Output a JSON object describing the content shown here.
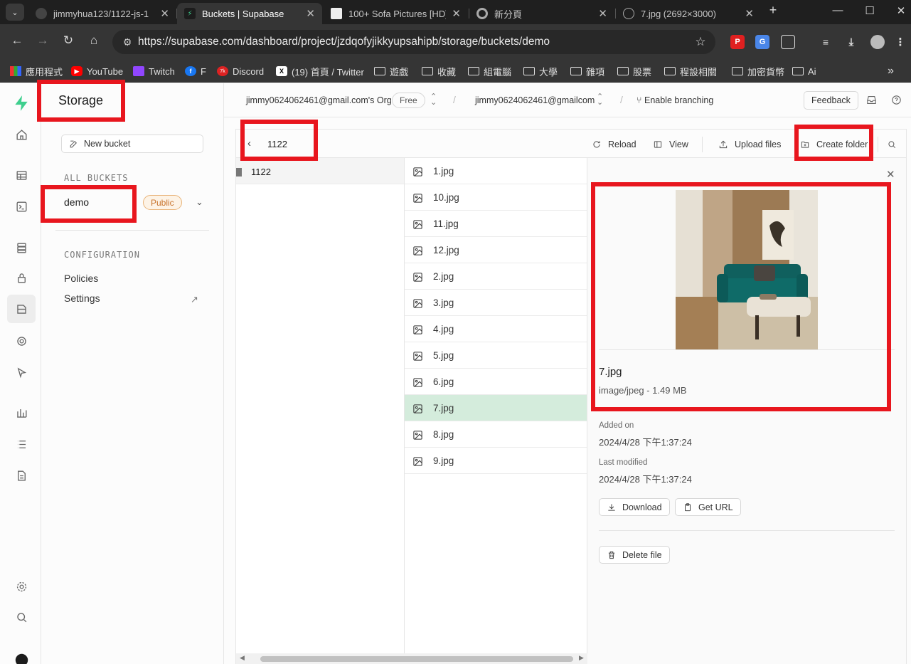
{
  "browser": {
    "tabs": [
      {
        "title": "jimmyhua123/1122-js-1",
        "close": "✕"
      },
      {
        "title": "Buckets | Supabase",
        "close": "✕"
      },
      {
        "title": "100+ Sofa Pictures [HD]",
        "close": "✕"
      },
      {
        "title": "新分頁",
        "close": "✕"
      },
      {
        "title": "7.jpg (2692×3000)",
        "close": "✕"
      }
    ],
    "new_tab": "+",
    "url": "https://supabase.com/dashboard/project/jzdqofyjikkyupsahipb/storage/buckets/demo",
    "bookmarks": [
      {
        "label": "應用程式",
        "icon": "apps-grid-icon"
      },
      {
        "label": "YouTube",
        "icon": "youtube-icon"
      },
      {
        "label": "Twitch",
        "icon": "twitch-icon"
      },
      {
        "label": "F",
        "icon": "facebook-icon"
      },
      {
        "label": "Discord",
        "icon": "discord-icon"
      },
      {
        "label": "(19) 首頁 / Twitter",
        "icon": "x-icon"
      },
      {
        "label": "遊戲",
        "icon": "folder-icon"
      },
      {
        "label": "收藏",
        "icon": "folder-icon"
      },
      {
        "label": "組電腦",
        "icon": "folder-icon"
      },
      {
        "label": "大學",
        "icon": "folder-icon"
      },
      {
        "label": "雜項",
        "icon": "folder-icon"
      },
      {
        "label": "股票",
        "icon": "folder-icon"
      },
      {
        "label": "程設相關",
        "icon": "folder-icon"
      },
      {
        "label": "加密貨幣",
        "icon": "folder-icon"
      },
      {
        "label": "Ai",
        "icon": "folder-icon"
      }
    ],
    "more_bookmarks": "»"
  },
  "sidebar": {
    "title": "Storage",
    "new_bucket_label": "New bucket",
    "all_buckets_heading": "ALL BUCKETS",
    "bucket": {
      "name": "demo",
      "badge": "Public"
    },
    "configuration_heading": "CONFIGURATION",
    "links": [
      "Policies",
      "Settings"
    ]
  },
  "topbar": {
    "org": "jimmy0624062461@gmail.com's Org",
    "plan_badge": "Free",
    "project": "jimmy0624062461@gmailcom",
    "branching": "Enable branching",
    "feedback": "Feedback"
  },
  "explorer": {
    "current_path": "1122",
    "actions": {
      "reload": "Reload",
      "view": "View",
      "upload": "Upload files",
      "create_folder": "Create folder"
    },
    "folders": [
      "1122"
    ],
    "files": [
      "1.jpg",
      "10.jpg",
      "11.jpg",
      "12.jpg",
      "2.jpg",
      "3.jpg",
      "4.jpg",
      "5.jpg",
      "6.jpg",
      "7.jpg",
      "8.jpg",
      "9.jpg"
    ],
    "selected_file": "7.jpg"
  },
  "preview": {
    "file_name": "7.jpg",
    "meta": "image/jpeg - 1.49 MB",
    "added_label": "Added on",
    "added_value": "2024/4/28 下午1:37:24",
    "modified_label": "Last modified",
    "modified_value": "2024/4/28 下午1:37:24",
    "download": "Download",
    "get_url": "Get URL",
    "delete": "Delete file"
  },
  "colors": {
    "brand_green": "#3ecf8e",
    "selected_row": "#d4ecdc",
    "annotation_red": "#e8161e",
    "public_badge": "#c8732c"
  }
}
